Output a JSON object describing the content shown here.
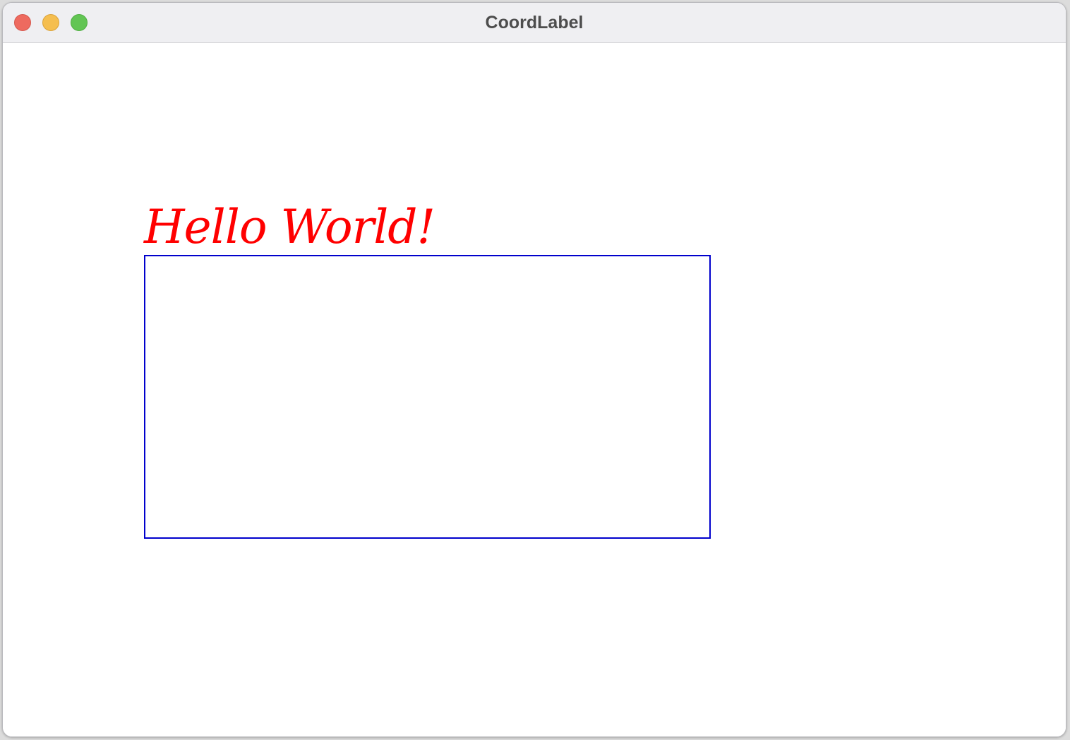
{
  "window": {
    "title": "CoordLabel"
  },
  "label": {
    "text": "Hello World!",
    "color": "#ff0000"
  },
  "rectangle": {
    "border_color": "#0000cc"
  },
  "colors": {
    "close": "#ee6a5f",
    "minimize": "#f5be4f",
    "maximize": "#62c554"
  }
}
